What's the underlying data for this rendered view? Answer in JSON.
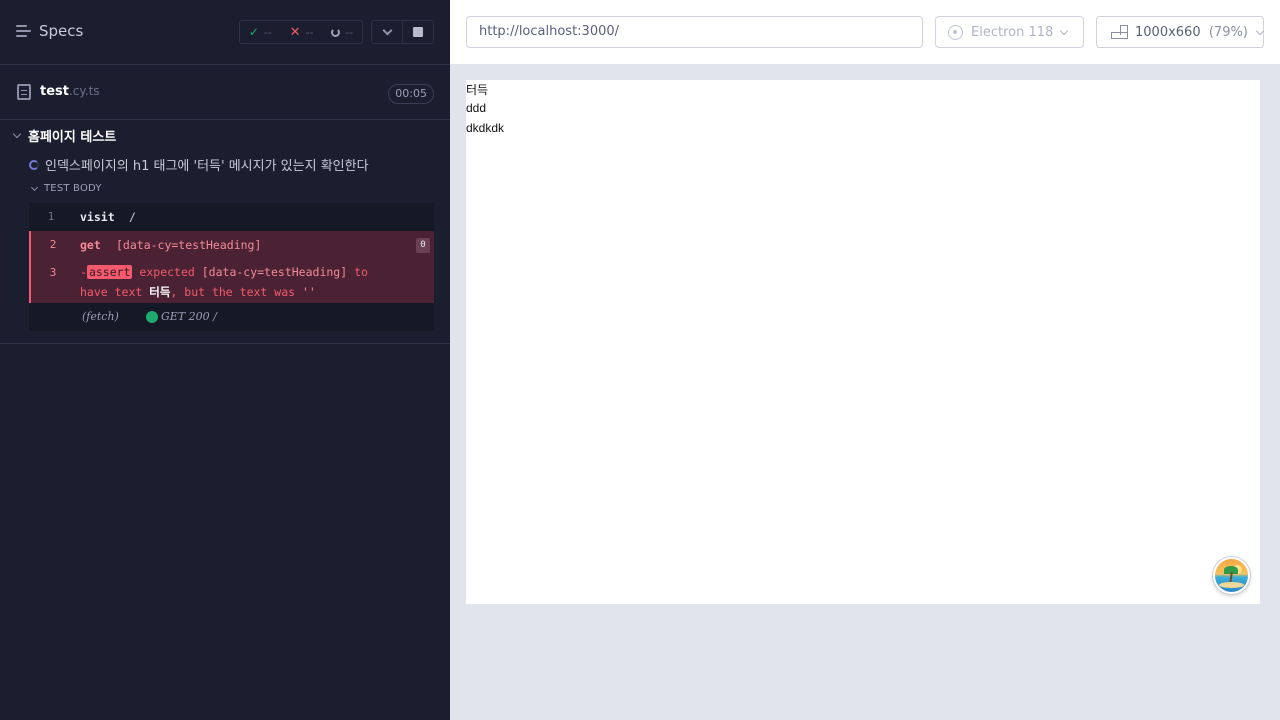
{
  "reporter": {
    "specs_label": "Specs",
    "stats": {
      "passed": "--",
      "failed": "--",
      "pending": "--"
    },
    "spec": {
      "base": "test",
      "ext": ".cy.ts",
      "duration": "00:05"
    },
    "suite": {
      "title": "홈페이지 테스트",
      "test_title": "인덱스페이지의 h1 태그에 '터득' 메시지가 있는지 확인한다",
      "body_label": "TEST BODY",
      "commands": [
        {
          "num": "1",
          "name": "visit",
          "message": "/"
        },
        {
          "num": "2",
          "name": "get",
          "message": "[data-cy=testHeading]",
          "count": "0"
        },
        {
          "num": "3",
          "prefix": "-",
          "name": "assert",
          "msg_a": "expected",
          "msg_b": "[data-cy=testHeading]",
          "msg_c": "to",
          "msg_d": "have text",
          "msg_e": "터득",
          "msg_f": ", but the text was",
          "msg_g": "''"
        }
      ],
      "fetch": {
        "label": "(fetch)",
        "request": "GET 200 /"
      }
    }
  },
  "aut": {
    "url": "http://localhost:3000/",
    "browser": "Electron 118",
    "viewport": "1000x660",
    "viewport_scale": "(79%)",
    "content_lines": [
      "터득",
      "ddd",
      "dkdkdk"
    ]
  },
  "colors": {
    "reporter_bg": "#1b1e2e",
    "fail_bg": "#4a2233",
    "fail_accent": "#f45a6d",
    "pass_accent": "#1fa971",
    "aut_bg": "#e1e3ed"
  }
}
